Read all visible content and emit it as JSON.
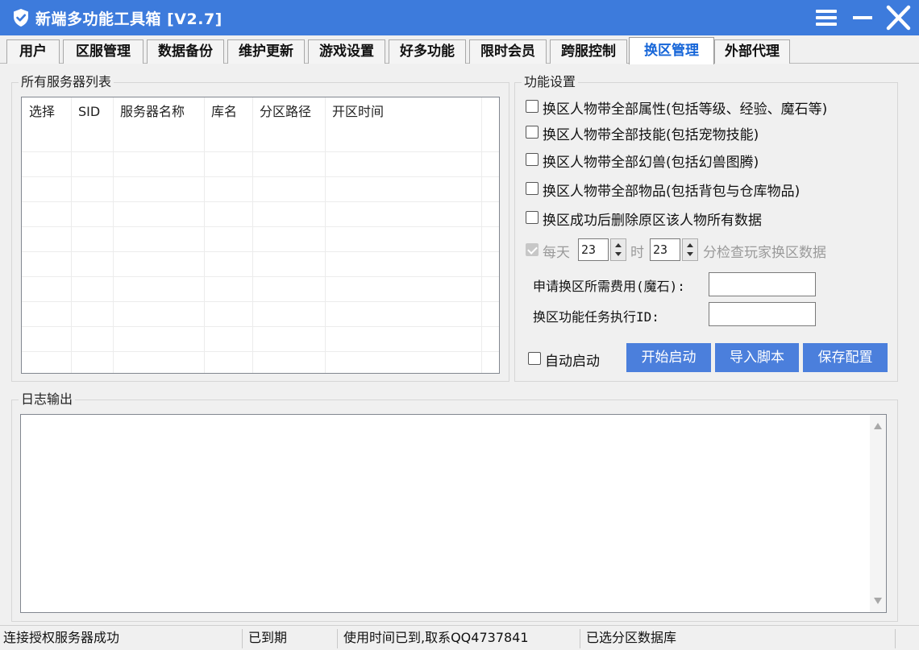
{
  "window": {
    "title": "新端多功能工具箱 [V2.7]",
    "accent_color": "#3d7bdc",
    "icons": {
      "logo": "shield-check-icon",
      "menu": "hamburger-menu-icon",
      "minimize": "minimize-icon",
      "close": "close-icon"
    }
  },
  "tabs": [
    {
      "label": "用户",
      "active": false
    },
    {
      "label": "区服管理",
      "active": false
    },
    {
      "label": "数据备份",
      "active": false
    },
    {
      "label": "维护更新",
      "active": false
    },
    {
      "label": "游戏设置",
      "active": false
    },
    {
      "label": "好多功能",
      "active": false
    },
    {
      "label": "限时会员",
      "active": false
    },
    {
      "label": "跨服控制",
      "active": false
    },
    {
      "label": "换区管理",
      "active": true
    },
    {
      "label": "外部代理",
      "active": false
    }
  ],
  "server_list": {
    "group_label": "所有服务器列表",
    "columns": [
      "选择",
      "SID",
      "服务器名称",
      "库名",
      "分区路径",
      "开区时间"
    ],
    "rows": []
  },
  "settings": {
    "group_label": "功能设置",
    "options": [
      {
        "label": "换区人物带全部属性(包括等级、经验、魔石等)",
        "checked": false
      },
      {
        "label": "换区人物带全部技能(包括宠物技能)",
        "checked": false
      },
      {
        "label": "换区人物带全部幻兽(包括幻兽图腾)",
        "checked": false
      },
      {
        "label": "换区人物带全部物品(包括背包与仓库物品)",
        "checked": false
      },
      {
        "label": "换区成功后删除原区该人物所有数据",
        "checked": false
      }
    ],
    "schedule": {
      "checked": true,
      "enabled": false,
      "prefix": "每天",
      "hour": "23",
      "hour_unit": "时",
      "minute": "23",
      "suffix": "分检查玩家换区数据"
    },
    "fee_label": "申请换区所需费用(魔石):",
    "fee_value": "",
    "task_label": "换区功能任务执行ID:",
    "task_value": "",
    "auto_start_label": "自动启动",
    "auto_start_checked": false,
    "buttons": {
      "start": "开始启动",
      "import": "导入脚本",
      "save": "保存配置"
    },
    "button_color": "#4b7fdc"
  },
  "log": {
    "group_label": "日志输出",
    "content": ""
  },
  "status": {
    "connection": "连接授权服务器成功",
    "expiry": "已到期",
    "usage": "使用时间已到,取系QQ4737841",
    "db": "已选分区数据库"
  }
}
